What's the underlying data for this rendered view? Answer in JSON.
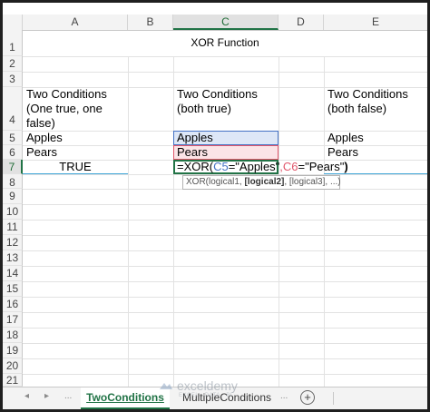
{
  "columns": [
    "A",
    "B",
    "C",
    "D",
    "E"
  ],
  "rows": [
    "1",
    "2",
    "3",
    "4",
    "5",
    "6",
    "7",
    "8",
    "9",
    "10",
    "11",
    "12",
    "13",
    "14",
    "15",
    "16",
    "17",
    "18",
    "19",
    "20",
    "21"
  ],
  "top_partial_text": "",
  "title": "XOR Function",
  "cells": {
    "a4": "Two Conditions (One true, one false)",
    "c4": "Two Conditions (both true)",
    "e4": "Two Conditions (both false)",
    "a5": "Apples",
    "c5": "Apples",
    "e5": "Apples",
    "a6": "Pears",
    "c6": "Pears",
    "e6": "Pears",
    "a7": "TRUE"
  },
  "formula": {
    "eq": "=XOR(",
    "ref1": "C5",
    "part1": "=\"Apples\"",
    "comma": ",",
    "ref2": "C6",
    "part2": "=\"Pears\"",
    "close": ")"
  },
  "tooltip": {
    "fn": "XOR(logical1, ",
    "bold": "[logical2]",
    "rest": ", [logical3], ...)"
  },
  "tabs": {
    "prev_icon": "◂",
    "next_icon": "▸",
    "ellipsis": "...",
    "active": "TwoConditions",
    "second": "MultipleConditions",
    "add_icon": "+"
  },
  "watermark": {
    "name": "exceldemy",
    "tagline": "EXCEL · DATA · BI"
  },
  "colors": {
    "ref1": "#4472c4",
    "ref2": "#e0566b",
    "accent": "#217346"
  }
}
